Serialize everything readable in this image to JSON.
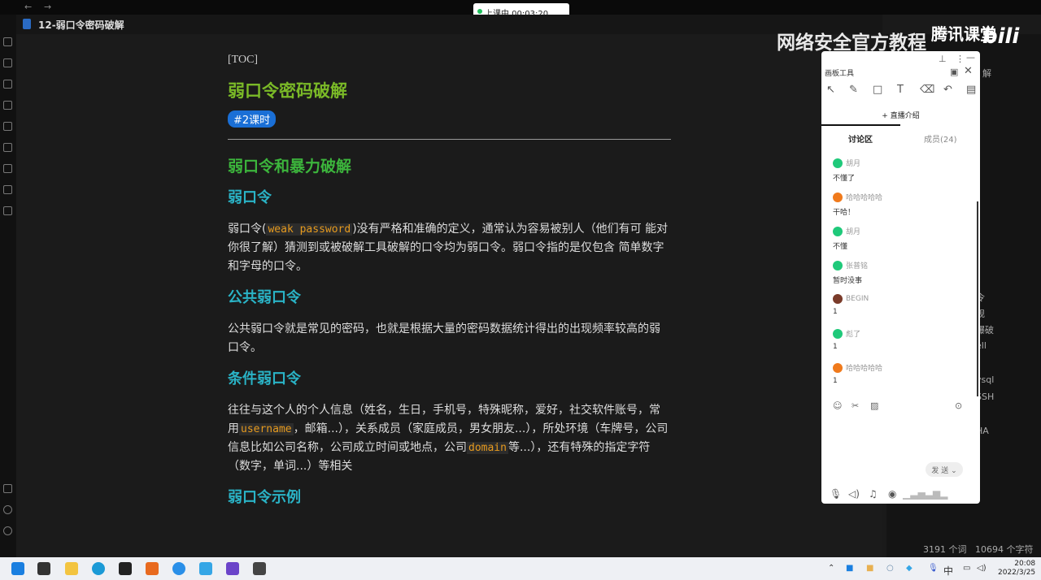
{
  "window": {
    "back": "←",
    "forward": "→",
    "doc_title": "12-弱口令密码破解"
  },
  "live": {
    "status": "上课中 00:03:20"
  },
  "watermark": {
    "text": "网络安全官方教程",
    "brand": "腾讯课堂",
    "logo": "bilibili"
  },
  "doc": {
    "toc": "[TOC]",
    "title": "弱口令密码破解",
    "badge": "#2课时",
    "h2": "弱口令和暴力破解",
    "s1_title": "弱口令",
    "s1_a": "弱口令(",
    "s1_code": "weak password",
    "s1_b": ")没有严格和准确的定义，通常认为容易被别人（他们有可 能对你很了解）猜测到或被破解工具破解的口令均为弱口令。弱口令指的是仅包含 简单数字和字母的口令。",
    "s2_title": "公共弱口令",
    "s2_text": "公共弱口令就是常见的密码，也就是根据大量的密码数据统计得出的出现频率较高的弱口令。",
    "s3_title": "条件弱口令",
    "s3_a": "往往与这个人的个人信息（姓名，生日，手机号，特殊昵称，爱好，社交软件账号，常用",
    "s3_code1": "username",
    "s3_b": "，邮箱...），关系成员（家庭成员，男女朋友...），所处环境（车牌号，公司信息比如公司名称，公司成立时间或地点，公司",
    "s3_code2": "domain",
    "s3_c": "等...），还有特殊的指定字符（数字，单词...）等相关",
    "s4_title": "弱口令示例"
  },
  "right_panel": {
    "fragments": [
      "解",
      "令",
      "规",
      "爆破",
      "ell",
      "ysql",
      "SSH",
      "HA"
    ]
  },
  "status_bar": {
    "words": "3191 个词",
    "chars": "10694 个字符"
  },
  "chat": {
    "title": "画板工具",
    "intro": "+ 直播介绍",
    "tab_discuss": "讨论区",
    "tab_members": "成员(24)",
    "messages": [
      {
        "name": "胡月",
        "text": "不懂了",
        "color": "#1fc97a"
      },
      {
        "name": "哈哈哈哈哈",
        "text": "干哈！",
        "color": "#f07a1c"
      },
      {
        "name": "胡月",
        "text": "不懂",
        "color": "#1fc97a"
      },
      {
        "name": "张普铭",
        "text": "暂时没事",
        "color": "#1fc97a"
      },
      {
        "name": "BEGIN",
        "text": "1",
        "color": "#7a3b2a"
      },
      {
        "name": "彪了",
        "text": "1",
        "color": "#1fc97a"
      },
      {
        "name": "哈哈哈哈哈",
        "text": "1",
        "color": "#f07a1c"
      }
    ],
    "send": "发 送"
  },
  "taskbar": {
    "ime": "中",
    "time": "20:08",
    "date": "2022/3/25"
  }
}
